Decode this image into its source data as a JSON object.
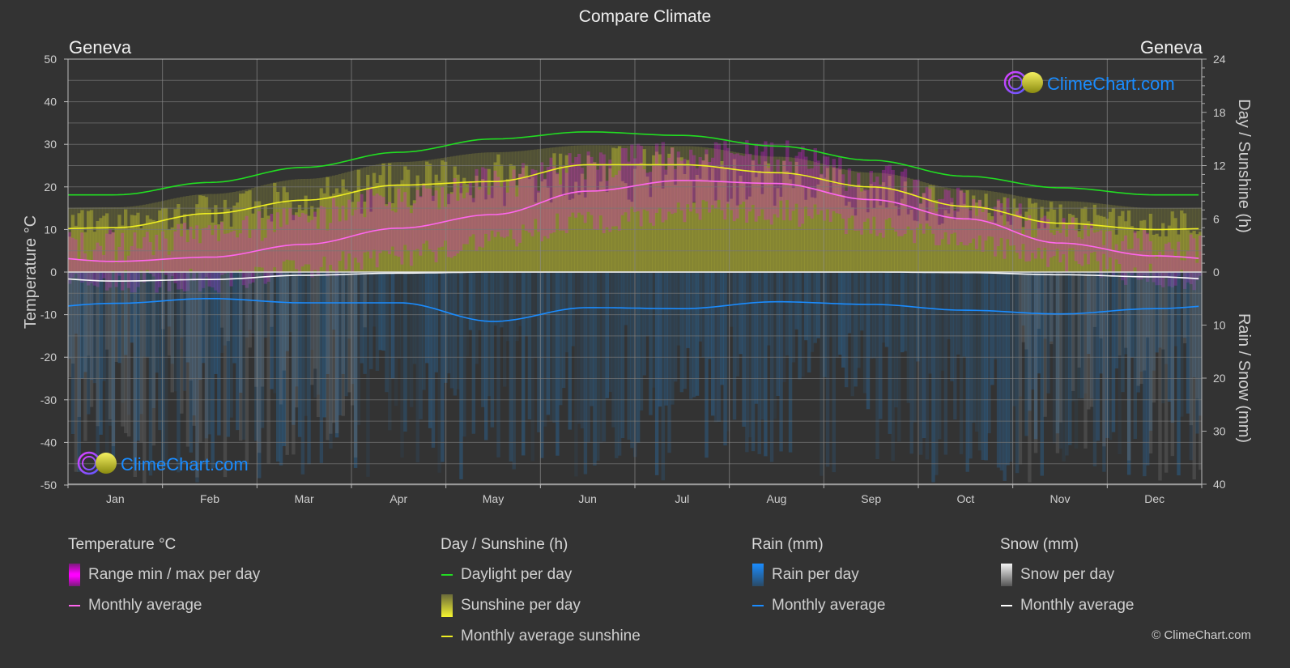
{
  "page": {
    "title": "Compare Climate",
    "location_left": "Geneva",
    "location_right": "Geneva",
    "watermark": "ClimeChart.com",
    "copyright": "© ClimeChart.com"
  },
  "colors": {
    "background": "#333333",
    "temperature_avg": "#ff66ee",
    "temperature_range": "#e020e0",
    "daylight": "#22dd22",
    "sunshine_avg": "#eeee22",
    "sunshine_bar": "#a8a830",
    "rain_avg": "#1a8cff",
    "rain_bar": "#2a6aa0",
    "snow_avg": "#ffffff",
    "snow_bar": "#888888",
    "brand": "#1a8cff"
  },
  "legend": {
    "temperature": {
      "heading": "Temperature °C",
      "range_label": "Range min / max per day",
      "avg_label": "Monthly average"
    },
    "sunshine": {
      "heading": "Day / Sunshine (h)",
      "daylight_label": "Daylight per day",
      "sunshine_label": "Sunshine per day",
      "avg_label": "Monthly average sunshine"
    },
    "rain": {
      "heading": "Rain (mm)",
      "bar_label": "Rain per day",
      "avg_label": "Monthly average"
    },
    "snow": {
      "heading": "Snow (mm)",
      "bar_label": "Snow per day",
      "avg_label": "Monthly average"
    }
  },
  "chart_data": {
    "type": "line",
    "title": "Compare Climate",
    "categories": [
      "Jan",
      "Feb",
      "Mar",
      "Apr",
      "May",
      "Jun",
      "Jul",
      "Aug",
      "Sep",
      "Oct",
      "Nov",
      "Dec"
    ],
    "axes": {
      "left": {
        "label": "Temperature °C",
        "range": [
          -50,
          50
        ],
        "ticks": [
          "50",
          "40",
          "30",
          "20",
          "10",
          "0",
          "-10",
          "-20",
          "-30",
          "-40",
          "-50"
        ]
      },
      "right_top": {
        "label": "Day / Sunshine (h)",
        "range": [
          0,
          24
        ],
        "ticks": [
          "24",
          "18",
          "12",
          "6",
          "0"
        ]
      },
      "right_bottom": {
        "label": "Rain / Snow (mm)",
        "range": [
          0,
          40
        ],
        "ticks": [
          "0",
          "10",
          "20",
          "30",
          "40"
        ]
      }
    },
    "grid": true,
    "series": [
      {
        "name": "Temperature monthly average",
        "axis": "left",
        "unit": "°C",
        "values": [
          2.5,
          3.5,
          6.5,
          10.3,
          13.5,
          19.0,
          21.5,
          20.8,
          17.0,
          12.5,
          6.8,
          3.8
        ]
      },
      {
        "name": "Daylight per day",
        "axis": "right_top",
        "unit": "h",
        "values": [
          8.7,
          10.1,
          11.8,
          13.5,
          15.0,
          15.8,
          15.4,
          14.2,
          12.6,
          10.8,
          9.5,
          8.7
        ]
      },
      {
        "name": "Monthly average sunshine",
        "axis": "right_top",
        "unit": "h",
        "values": [
          5.0,
          6.6,
          8.1,
          9.8,
          10.2,
          12.1,
          12.1,
          11.2,
          9.6,
          7.4,
          5.5,
          4.8
        ]
      },
      {
        "name": "Rain monthly average",
        "axis": "right_bottom",
        "unit": "mm",
        "values": [
          5.9,
          5.0,
          5.8,
          5.8,
          9.3,
          6.7,
          6.9,
          5.6,
          6.1,
          7.2,
          7.9,
          6.9
        ]
      },
      {
        "name": "Snow monthly average",
        "axis": "right_bottom",
        "unit": "mm",
        "values": [
          1.7,
          1.4,
          0.6,
          0.2,
          0.0,
          0.0,
          0.0,
          0.0,
          0.0,
          0.1,
          0.5,
          0.9
        ]
      }
    ],
    "daily_ranges": {
      "temperature_max_typical": [
        6,
        8,
        13,
        17,
        21,
        25,
        28,
        27,
        22,
        16,
        10,
        6
      ],
      "temperature_min_typical": [
        -2,
        -2,
        1,
        4,
        8,
        12,
        14,
        14,
        11,
        7,
        3,
        -1
      ],
      "sunshine_envelope_h": [
        7.3,
        8.8,
        10.5,
        12.4,
        13.5,
        14.3,
        14.2,
        13.0,
        11.2,
        9.3,
        8.0,
        7.2
      ]
    },
    "legend_position": "bottom"
  }
}
